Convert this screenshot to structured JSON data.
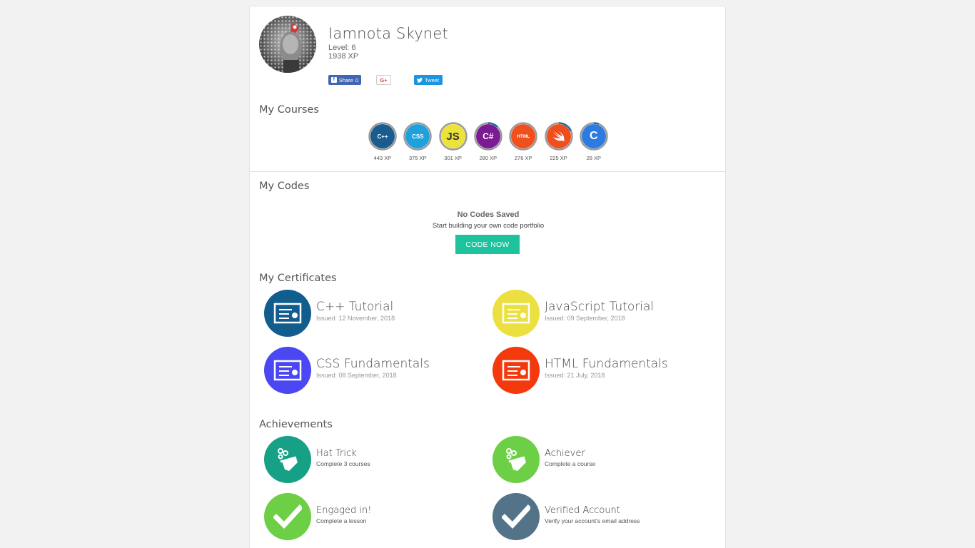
{
  "profile": {
    "name": "Iamnota Skynet",
    "level": "Level: 6",
    "xp": "1938 XP",
    "share": {
      "facebook_label": "Share",
      "facebook_count": "0",
      "google_label": "G+",
      "tweet_label": "Tweet"
    }
  },
  "courses_section": {
    "title": "My Courses",
    "courses": [
      {
        "label": "C++",
        "xp": "443 XP",
        "color": "#1a5c8e",
        "progress": 1.0
      },
      {
        "label": "CSS",
        "xp": "375 XP",
        "color": "#1fa1dd",
        "progress": 1.0
      },
      {
        "label": "JS",
        "xp": "301 XP",
        "color": "#ebe23a",
        "progress": 1.0
      },
      {
        "label": "C#",
        "xp": "280 XP",
        "color": "#7b1b93",
        "progress": 0.12
      },
      {
        "label": "HTML",
        "xp": "276 XP",
        "color": "#f0501e",
        "progress": 1.0
      },
      {
        "label": "",
        "xp": "225 XP",
        "color": "#f04e1d",
        "progress": 0.18
      },
      {
        "label": "C",
        "xp": "28 XP",
        "color": "#2b7be0",
        "progress": 0.06
      }
    ]
  },
  "codes_section": {
    "title": "My Codes",
    "empty_title": "No Codes Saved",
    "empty_subtitle": "Start building your own code portfolio",
    "button_label": "CODE NOW"
  },
  "certificates_section": {
    "title": "My Certificates",
    "items": [
      {
        "title": "C++ Tutorial",
        "issued": "Issued: 12 November, 2018",
        "color": "#115d8e"
      },
      {
        "title": "JavaScript Tutorial",
        "issued": "Issued: 09 September, 2018",
        "color": "#ebe040"
      },
      {
        "title": "CSS Fundamentals",
        "issued": "Issued: 08 September, 2018",
        "color": "#4a47f3"
      },
      {
        "title": "HTML Fundamentals",
        "issued": "Issued: 21 July, 2018",
        "color": "#f4390c"
      }
    ]
  },
  "achievements_section": {
    "title": "Achievements",
    "items": [
      {
        "title": "Hat Trick",
        "description": "Complete 3 courses",
        "color": "#16a086",
        "icon": "magic-hat-icon"
      },
      {
        "title": "Achiever",
        "description": "Complete a course",
        "color": "#6ccf46",
        "icon": "magic-hat-icon"
      },
      {
        "title": "Engaged in!",
        "description": "Complete a lesson",
        "color": "#6ccf46",
        "icon": "checkmark-icon"
      },
      {
        "title": "Verified Account",
        "description": "Verify your account's email address",
        "color": "#537389",
        "icon": "checkmark-icon"
      }
    ]
  }
}
